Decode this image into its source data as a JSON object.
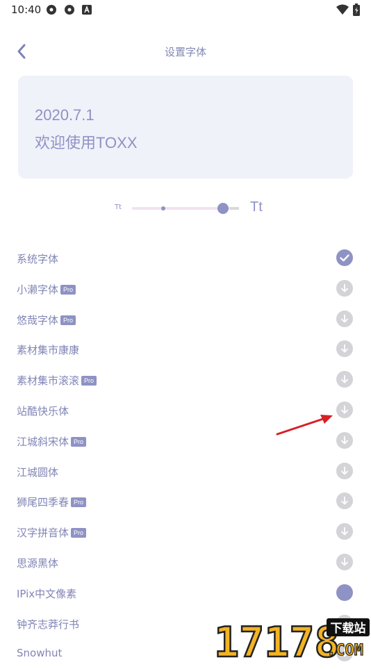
{
  "status_bar": {
    "time": "10:40"
  },
  "header": {
    "title": "设置字体"
  },
  "preview": {
    "line1": "2020.7.1",
    "line2": "欢迎使用TOXX"
  },
  "slider": {
    "small_label": "Tt",
    "large_label": "Tt",
    "level": 0.85
  },
  "pro_label": "Pro",
  "fonts": [
    {
      "name": "系统字体",
      "pro": false,
      "status": "selected"
    },
    {
      "name": "小濑字体",
      "pro": true,
      "status": "download"
    },
    {
      "name": "悠哉字体",
      "pro": true,
      "status": "download"
    },
    {
      "name": "素材集市康康",
      "pro": false,
      "status": "download"
    },
    {
      "name": "素材集市滚滚",
      "pro": true,
      "status": "download"
    },
    {
      "name": "站酷快乐体",
      "pro": false,
      "status": "download"
    },
    {
      "name": "江城斜宋体",
      "pro": true,
      "status": "download"
    },
    {
      "name": "江城圆体",
      "pro": false,
      "status": "download"
    },
    {
      "name": "狮尾四季春",
      "pro": true,
      "status": "download"
    },
    {
      "name": "汉字拼音体",
      "pro": true,
      "status": "download"
    },
    {
      "name": "思源黑体",
      "pro": false,
      "status": "download"
    },
    {
      "name": "IPix中文像素",
      "pro": false,
      "status": "loading"
    },
    {
      "name": "钟齐志莽行书",
      "pro": false,
      "status": "download"
    },
    {
      "name": "Snowhut",
      "pro": false,
      "status": "download"
    }
  ],
  "watermark": {
    "number": "17178",
    "tag": "下载站",
    "domain": ".COM"
  },
  "colors": {
    "accent": "#8e92c4",
    "text": "#8085b5",
    "card_bg": "#f0f2f9",
    "download_icon_bg": "#d3d3d8"
  }
}
